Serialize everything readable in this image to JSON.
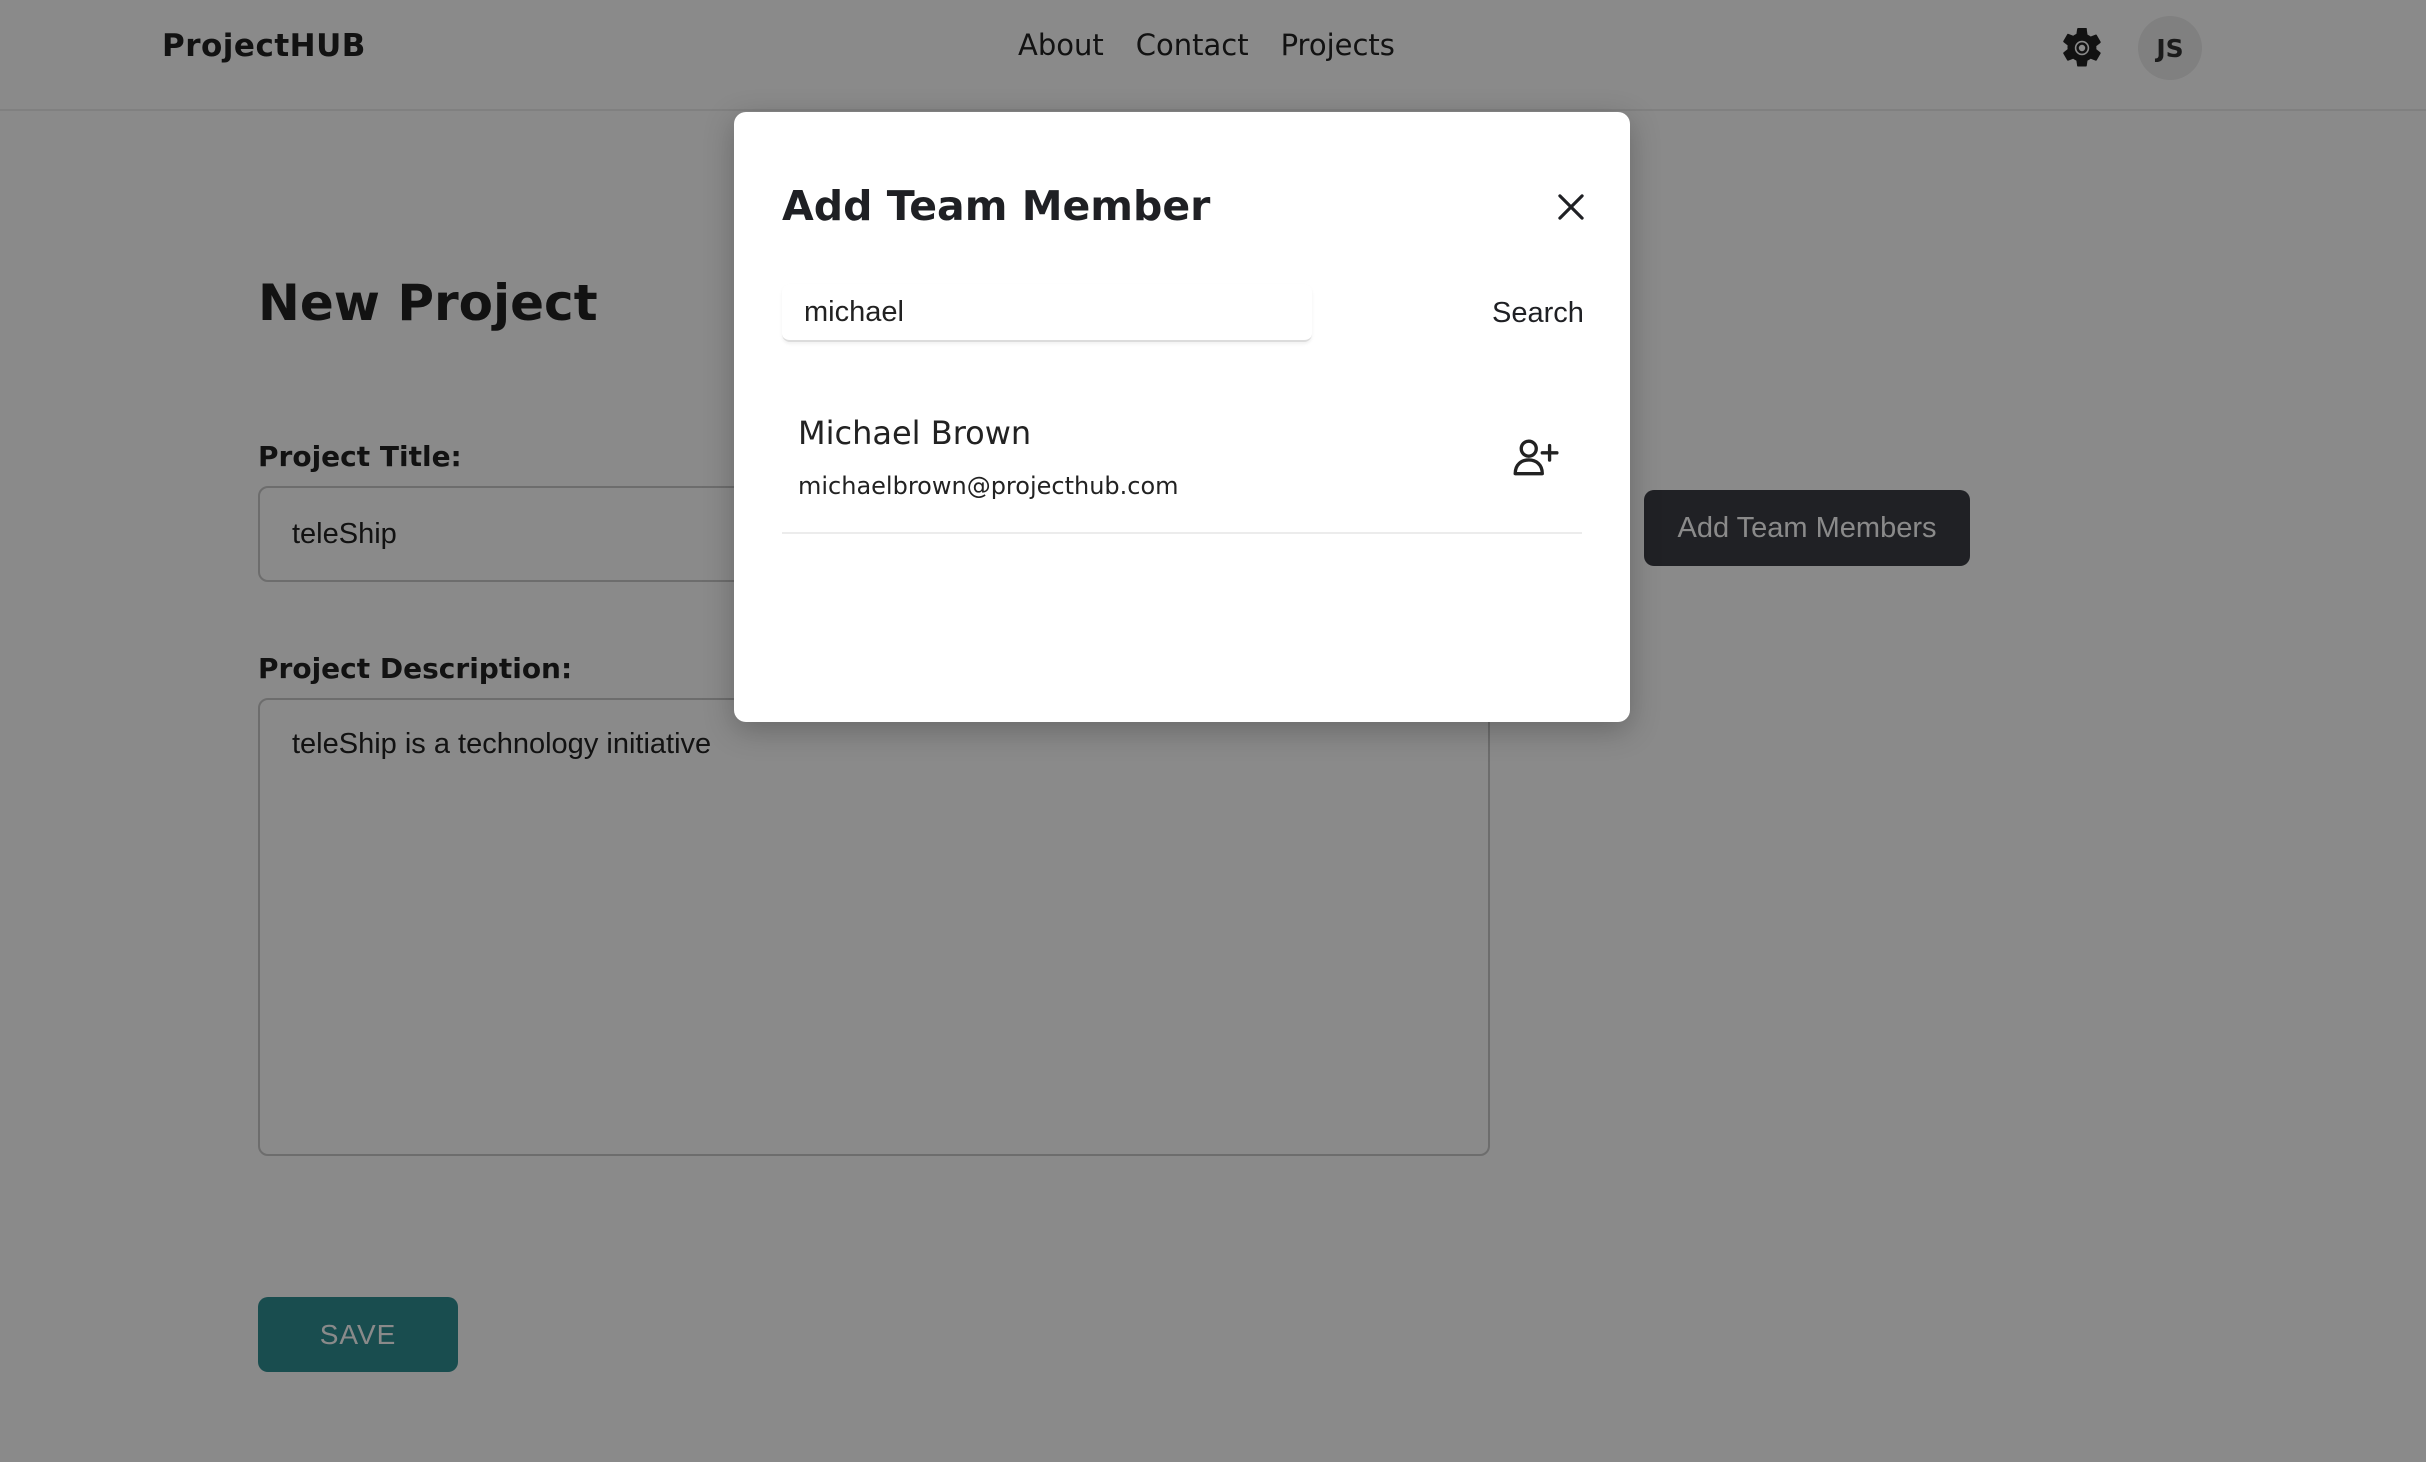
{
  "header": {
    "brand": "ProjectHUB",
    "nav": [
      "About",
      "Contact",
      "Projects"
    ],
    "settings_icon": "gear-icon",
    "avatar_initials": "JS"
  },
  "page": {
    "title": "New Project",
    "project_title_label": "Project Title:",
    "project_title_value": "teleShip",
    "project_description_label": "Project Description:",
    "project_description_value": "teleShip is a technology initiative",
    "add_team_members_label": "Add Team Members",
    "save_label": "SAVE"
  },
  "modal": {
    "title": "Add Team Member",
    "close_icon": "close-icon",
    "search_value": "michael",
    "search_button": "Search",
    "results": [
      {
        "name": "Michael Brown",
        "email": "michaelbrown@projecthub.com",
        "action_icon": "add-user-icon"
      }
    ]
  },
  "colors": {
    "primary_dark": "#3b3e45",
    "save_teal": "#2f8e92",
    "overlay": "rgba(0,0,0,0.46)"
  }
}
